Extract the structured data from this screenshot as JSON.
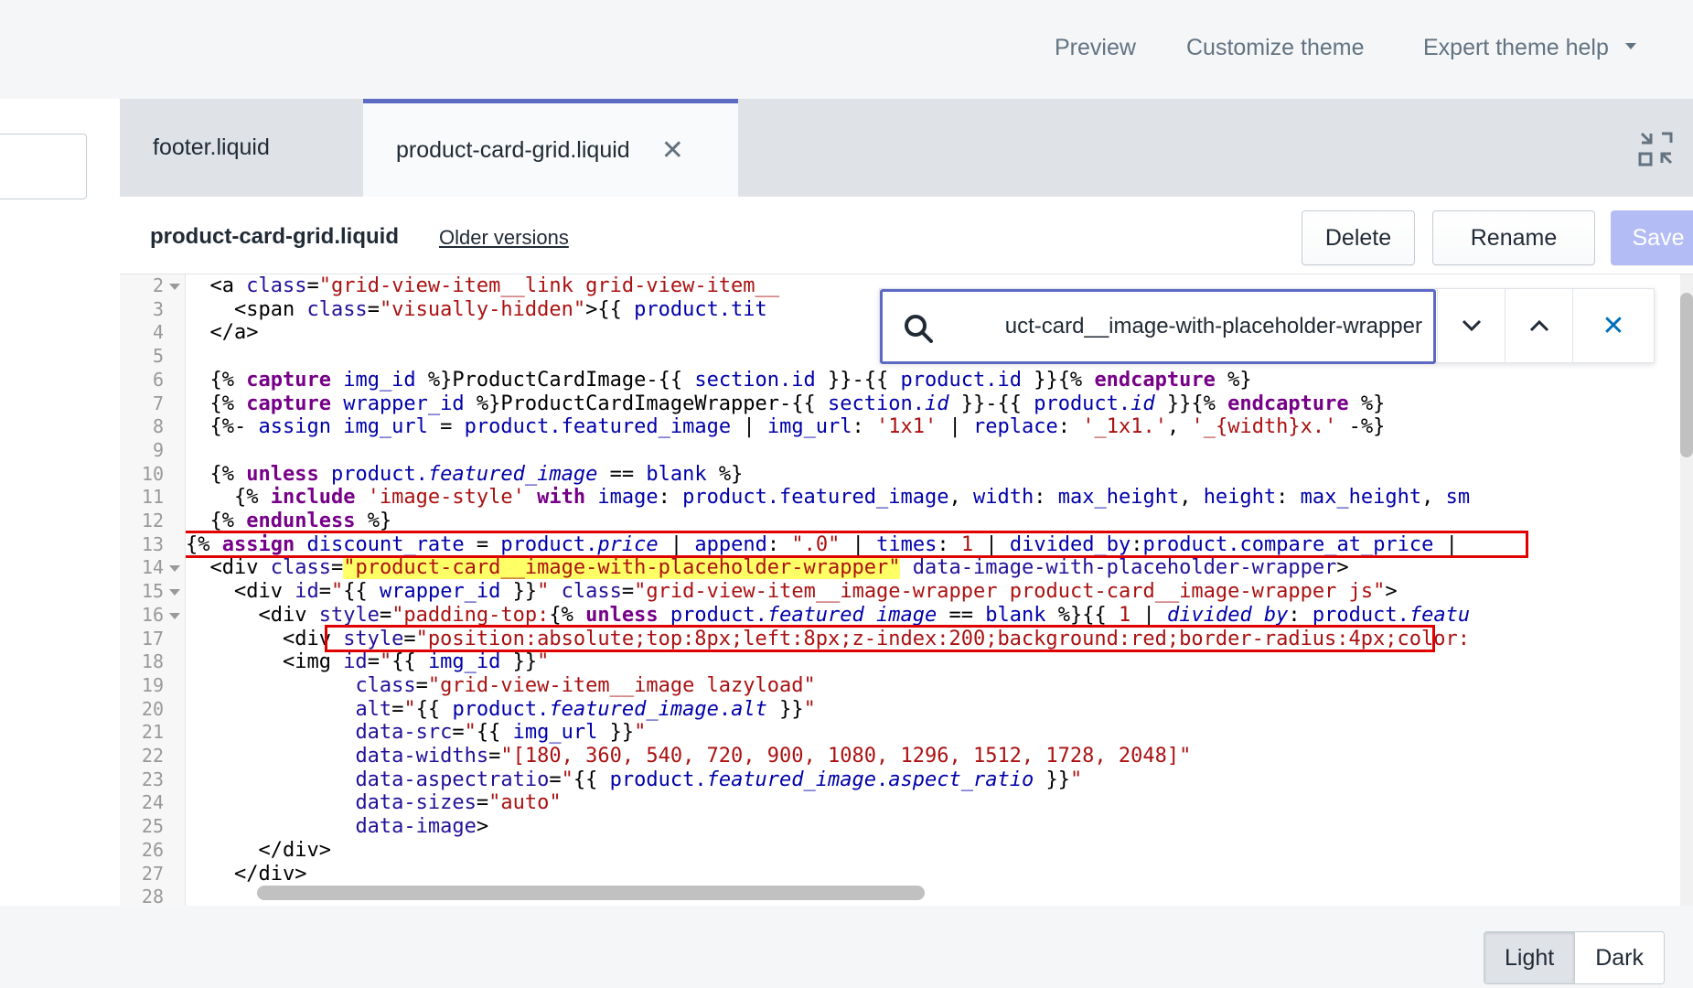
{
  "topbar": {
    "preview": "Preview",
    "customize": "Customize theme",
    "expert_help": "Expert theme help"
  },
  "tabs": {
    "footer": "footer.liquid",
    "product": "product-card-grid.liquid",
    "close_glyph": "✕"
  },
  "file_header": {
    "name": "product-card-grid.liquid",
    "older_versions": "Older versions",
    "delete": "Delete",
    "rename": "Rename",
    "save": "Save"
  },
  "find": {
    "value": "uct-card__image-with-placeholder-wrapper",
    "next_glyph": "⌄",
    "prev_glyph": "⌃",
    "close_glyph": "✕"
  },
  "code": {
    "line_numbers": [
      "2",
      "3",
      "4",
      "5",
      "6",
      "7",
      "8",
      "9",
      "10",
      "11",
      "12",
      "13",
      "14",
      "15",
      "16",
      "17",
      "18",
      "19",
      "20",
      "21",
      "22",
      "23",
      "24",
      "25",
      "26",
      "27",
      "28"
    ],
    "folded_lines": [
      "2",
      "14",
      "15",
      "16"
    ]
  },
  "theme_toggle": {
    "light": "Light",
    "dark": "Dark"
  },
  "colors": {
    "accent": "#5c6ac4",
    "save_disabled": "#b3bcf5",
    "annotation": "#e00000",
    "search_highlight": "#ffff66"
  },
  "icons": {
    "fullscreen": "exit-fullscreen-icon",
    "search": "magnifier-icon"
  }
}
